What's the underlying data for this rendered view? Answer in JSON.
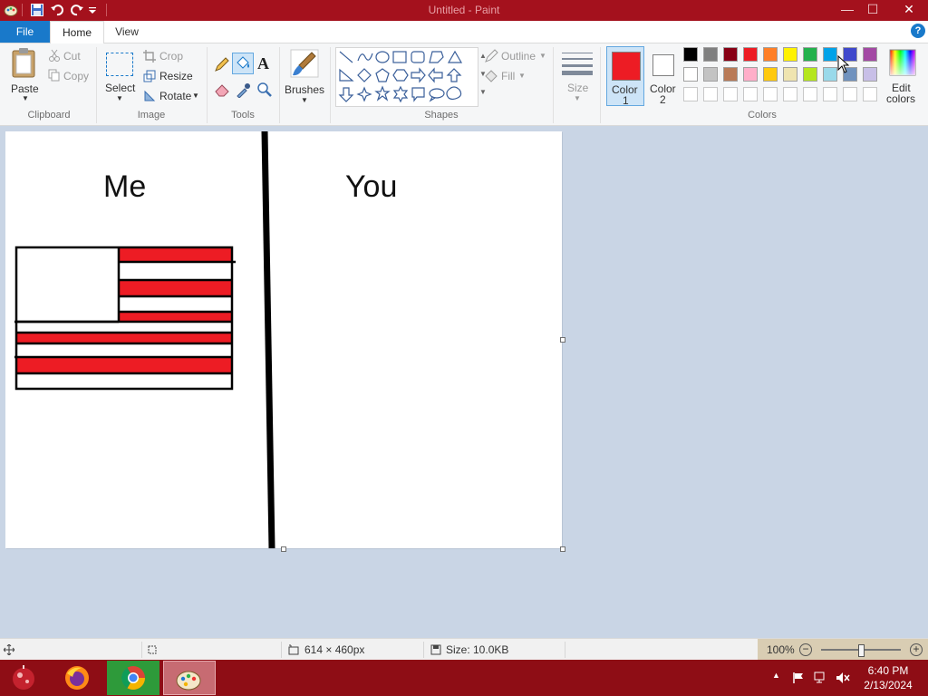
{
  "window": {
    "title": "Untitled - Paint",
    "minimize": "—",
    "maximize": "☐",
    "close": "✕"
  },
  "tabs": {
    "file": "File",
    "home": "Home",
    "view": "View",
    "help": "?"
  },
  "ribbon": {
    "clipboard": {
      "paste": "Paste",
      "cut": "Cut",
      "copy": "Copy",
      "label": "Clipboard"
    },
    "image": {
      "select": "Select",
      "crop": "Crop",
      "resize": "Resize",
      "rotate": "Rotate",
      "label": "Image"
    },
    "tools": {
      "label": "Tools",
      "text_tool": "A"
    },
    "brushes": {
      "label": "Brushes"
    },
    "shapes": {
      "outline": "Outline",
      "fill": "Fill",
      "label": "Shapes"
    },
    "size": {
      "label": "Size"
    },
    "color1": {
      "label_line1": "Color",
      "label_line2": "1",
      "value": "#ed1c24"
    },
    "color2": {
      "label_line1": "Color",
      "label_line2": "2",
      "value": "#ffffff"
    },
    "colors": {
      "label": "Colors",
      "edit_line1": "Edit",
      "edit_line2": "colors",
      "row1": [
        "#000000",
        "#7f7f7f",
        "#880015",
        "#ed1c24",
        "#ff7f27",
        "#fff200",
        "#22b14c",
        "#00a2e8",
        "#3f48cc",
        "#a349a4"
      ],
      "row2": [
        "#ffffff",
        "#c3c3c3",
        "#b97a57",
        "#ffaec9",
        "#ffc90e",
        "#efe4b0",
        "#b5e61d",
        "#99d9ea",
        "#7092be",
        "#c8bfe7"
      ],
      "row3": [
        "#ffffff",
        "#ffffff",
        "#ffffff",
        "#ffffff",
        "#ffffff",
        "#ffffff",
        "#ffffff",
        "#ffffff",
        "#ffffff",
        "#ffffff"
      ]
    }
  },
  "canvas": {
    "left_heading": "Me",
    "right_heading": "You",
    "flag_red": "#ed1c24"
  },
  "status": {
    "dimensions": "614 × 460px",
    "size": "Size: 10.0KB",
    "zoom": "100%",
    "zoom_level": 1.0
  },
  "taskbar": {
    "time": "6:40 PM",
    "date": "2/13/2024"
  }
}
